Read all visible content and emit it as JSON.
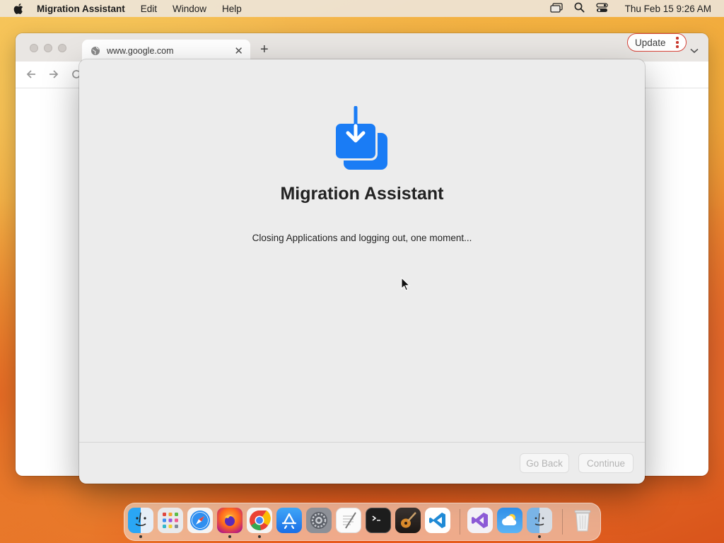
{
  "menubar": {
    "app_name": "Migration Assistant",
    "items": [
      "Edit",
      "Window",
      "Help"
    ],
    "clock": "Thu Feb 15  9:26 AM",
    "status_icons": [
      "screen-mirroring-icon",
      "spotlight-search-icon",
      "control-center-icon"
    ]
  },
  "browser": {
    "tab_title": "www.google.com",
    "update_label": "Update",
    "accent_color": "#d7453a"
  },
  "dialog": {
    "title": "Migration Assistant",
    "message": "Closing Applications and logging out, one moment...",
    "go_back_label": "Go Back",
    "continue_label": "Continue",
    "icon_color": "#1a7cf5"
  },
  "dock": {
    "apps": [
      {
        "name": "Finder",
        "running": true
      },
      {
        "name": "Launchpad",
        "running": false
      },
      {
        "name": "Safari",
        "running": false
      },
      {
        "name": "Firefox",
        "running": true
      },
      {
        "name": "Google Chrome",
        "running": true
      },
      {
        "name": "App Store",
        "running": false
      },
      {
        "name": "System Settings",
        "running": false
      },
      {
        "name": "TextEdit",
        "running": false
      },
      {
        "name": "Terminal",
        "running": false
      },
      {
        "name": "GarageBand",
        "running": false
      },
      {
        "name": "Visual Studio Code",
        "running": false
      },
      {
        "name": "Visual Studio",
        "running": false
      },
      {
        "name": "Weather",
        "running": false
      },
      {
        "name": "Migration Assistant",
        "running": true
      },
      {
        "name": "Trash",
        "running": false
      }
    ]
  }
}
